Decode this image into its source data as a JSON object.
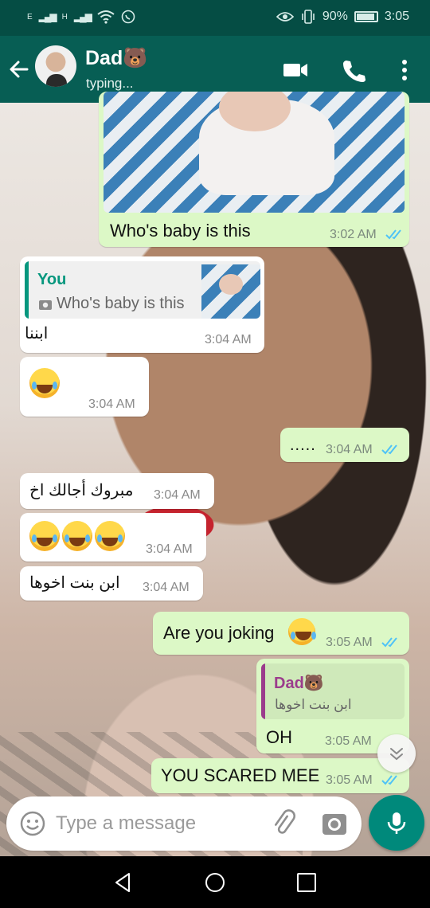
{
  "status_bar": {
    "signal_1": "E",
    "signal_2": "H",
    "battery_percent": "90%",
    "time": "3:05"
  },
  "header": {
    "contact_name": "Dad🐻",
    "contact_status": "typing..."
  },
  "messages": [
    {
      "direction": "outgoing",
      "type": "image",
      "caption": "Who's baby is this",
      "time": "3:02 AM",
      "read": true
    },
    {
      "direction": "incoming",
      "type": "reply",
      "quote_author": "You",
      "quote_text": "Who's baby is this",
      "text": "ابننا",
      "time": "3:04 AM"
    },
    {
      "direction": "incoming",
      "type": "emoji",
      "emoji": "😂",
      "time": "3:04 AM"
    },
    {
      "direction": "outgoing",
      "type": "text",
      "text": ".....",
      "time": "3:04 AM",
      "read": true
    },
    {
      "direction": "incoming",
      "type": "text",
      "text": "مبروك أجالك اخ",
      "time": "3:04 AM"
    },
    {
      "direction": "incoming",
      "type": "emoji",
      "emoji": "😂😂😂",
      "time": "3:04 AM"
    },
    {
      "direction": "incoming",
      "type": "text",
      "text": "ابن بنت اخوها",
      "time": "3:04 AM"
    },
    {
      "direction": "outgoing",
      "type": "text",
      "text": "Are you joking",
      "emoji": "😭",
      "time": "3:05 AM",
      "read": true
    },
    {
      "direction": "outgoing",
      "type": "reply",
      "quote_author": "Dad🐻",
      "quote_text": "ابن بنت اخوها",
      "text": "OH",
      "time": "3:05 AM"
    },
    {
      "direction": "outgoing",
      "type": "text",
      "text": "YOU SCARED MEE",
      "time": "3:05 AM",
      "read": true
    }
  ],
  "composer": {
    "placeholder": "Type a message"
  },
  "colors": {
    "header": "#075e54",
    "status_bar": "#054d44",
    "outgoing_bubble": "#dcf8c6",
    "incoming_bubble": "#ffffff",
    "read_ticks": "#4fc3f7",
    "mic_button": "#00897b",
    "quote_you": "#06977e",
    "quote_dad": "#9b3c8c"
  },
  "icons": [
    "back-arrow-icon",
    "video-call-icon",
    "phone-icon",
    "more-vert-icon",
    "camera-small-icon",
    "scroll-down-icon",
    "emoji-icon",
    "attach-icon",
    "camera-icon",
    "mic-icon",
    "nav-back-icon",
    "nav-home-icon",
    "nav-recents-icon"
  ]
}
